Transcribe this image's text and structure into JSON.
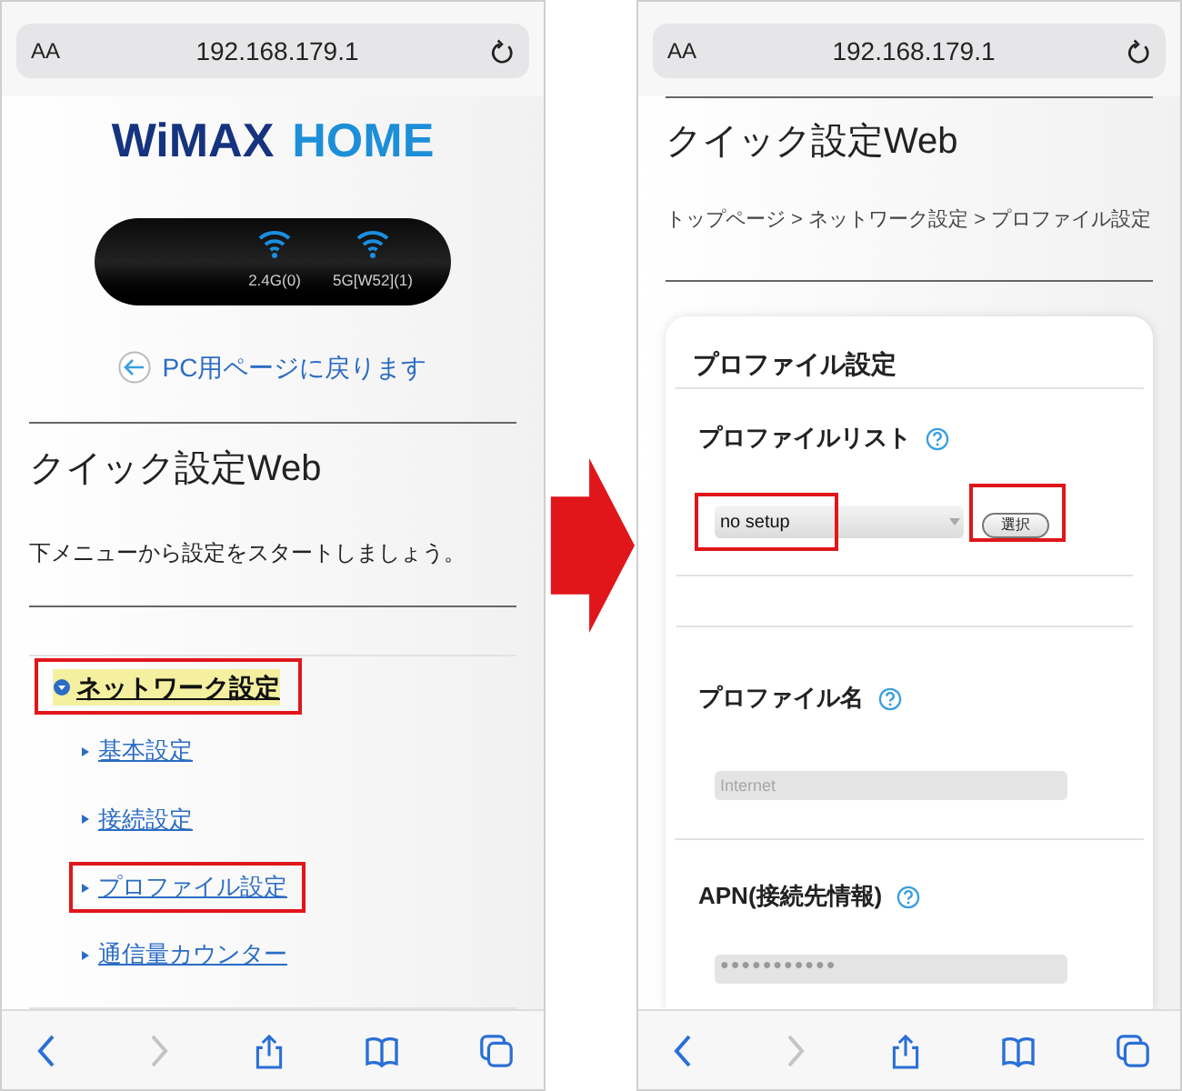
{
  "left_screen": {
    "address_bar": {
      "text_size_button": "AA",
      "url": "192.168.179.1"
    },
    "logo": {
      "part_1": "WiMAX",
      "part_2": "HOME"
    },
    "device_status": {
      "bands": [
        {
          "label": "2.4G(0)"
        },
        {
          "label": "5G[W52](1)"
        }
      ]
    },
    "back_link": "PC用ページに戻ります",
    "title": "クイック設定Web",
    "intro": "下メニューから設定をスタートしましょう。",
    "menu": [
      {
        "label": "ネットワーク設定",
        "expanded": true,
        "current": true,
        "annotated": true,
        "children": [
          {
            "label": "基本設定",
            "annotated": false
          },
          {
            "label": "接続設定",
            "annotated": false
          },
          {
            "label": "プロファイル設定",
            "annotated": true
          },
          {
            "label": "通信量カウンター",
            "annotated": false
          }
        ]
      }
    ],
    "toolbar": {
      "back_disabled": false,
      "forward_disabled": true
    }
  },
  "right_screen": {
    "address_bar": {
      "text_size_button": "AA",
      "url": "192.168.179.1"
    },
    "title": "クイック設定Web",
    "breadcrumb": "トップページ > ネットワーク設定 > プロファイル設定",
    "card": {
      "heading": "プロファイル設定",
      "profile_list": {
        "label": "プロファイルリスト",
        "select_value": "no setup",
        "select_annotated": true,
        "button": "選択",
        "button_annotated": true
      },
      "profile_name": {
        "label": "プロファイル名",
        "value": "Internet",
        "disabled": true
      },
      "apn": {
        "label": "APN(接続先情報)",
        "value": "●●●●●●●●●●●"
      }
    },
    "toolbar": {
      "back_disabled": false,
      "forward_disabled": true
    }
  }
}
